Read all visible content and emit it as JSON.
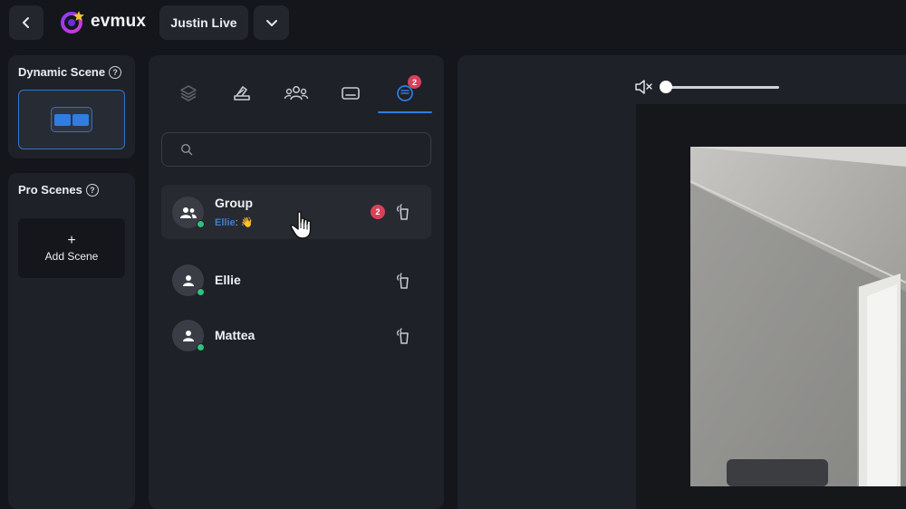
{
  "header": {
    "app_name": "evmux",
    "event_name": "Justin Live",
    "icons": {
      "back": "chevron-left-icon",
      "dropdown": "chevron-down-icon",
      "logo": "evmux-logo-icon"
    }
  },
  "dynamic_scene": {
    "title": "Dynamic Scene",
    "help": "?"
  },
  "pro_scenes": {
    "title": "Pro Scenes",
    "help": "?",
    "add_plus": "+",
    "add_label": "Add Scene"
  },
  "tabs": [
    {
      "id": "layers",
      "icon": "layers-icon",
      "active": false
    },
    {
      "id": "brand",
      "icon": "paint-brush-icon",
      "active": false
    },
    {
      "id": "people",
      "icon": "people-icon",
      "active": false
    },
    {
      "id": "banner",
      "icon": "banner-icon",
      "active": false
    },
    {
      "id": "chat",
      "icon": "chat-icon",
      "active": true,
      "badge": "2"
    }
  ],
  "search": {
    "placeholder": "",
    "value": ""
  },
  "chats": [
    {
      "name": "Group",
      "type": "group",
      "active": true,
      "preview_sender": "Ellie",
      "preview_sep": ":",
      "preview_text": "👋",
      "badge": "2",
      "online": true
    },
    {
      "name": "Ellie",
      "type": "user",
      "active": false,
      "online": true
    },
    {
      "name": "Mattea",
      "type": "user",
      "active": false,
      "online": true
    }
  ],
  "preview": {
    "volume_icon": "speaker-muted-icon",
    "volume_level": 0
  },
  "colors": {
    "accent": "#2f7de0",
    "badge": "#d8415a",
    "online": "#2fc27a",
    "panel": "#1e2128",
    "bg": "#14161b"
  }
}
